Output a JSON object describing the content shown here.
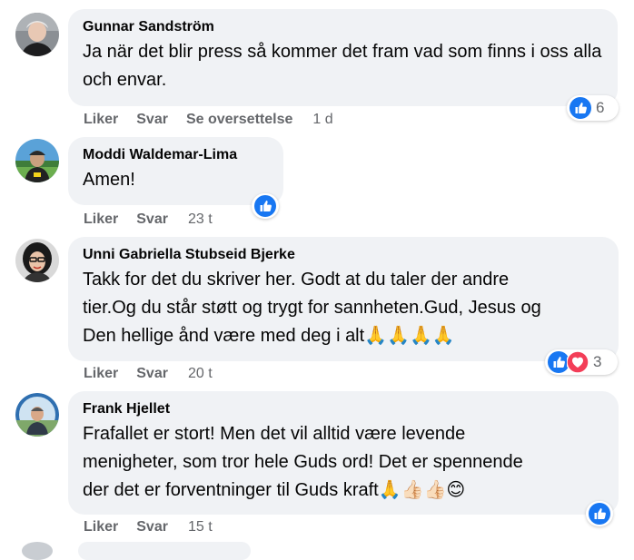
{
  "comments": [
    {
      "author": "Gunnar Sandström",
      "text": "Ja när det blir press så kommer det fram vad som finns i oss alla och envar.",
      "actions": {
        "like": "Liker",
        "reply": "Svar",
        "translate": "Se oversettelse"
      },
      "time": "1 d",
      "reactions": {
        "types": [
          "like"
        ],
        "count": "6"
      }
    },
    {
      "author": "Moddi Waldemar-Lima",
      "text": "Amen!",
      "actions": {
        "like": "Liker",
        "reply": "Svar"
      },
      "time": "23 t",
      "reactions": {
        "types": [
          "like"
        ],
        "count": ""
      }
    },
    {
      "author": "Unni Gabriella Stubseid Bjerke",
      "text_line1": "Takk for det du skriver her. Godt at du taler der andre",
      "text_line2": "tier.Og du står støtt og trygt for sannheten.Gud, Jesus og",
      "text_line3": "Den hellige ånd være med deg i alt",
      "text_emoji": "🙏🙏🙏🙏",
      "actions": {
        "like": "Liker",
        "reply": "Svar"
      },
      "time": "20 t",
      "reactions": {
        "types": [
          "like",
          "love"
        ],
        "count": "3"
      }
    },
    {
      "author": "Frank Hjellet",
      "text_line1": "Frafallet er stort! Men det vil alltid være levende",
      "text_line2": "menigheter, som tror hele Guds ord! Det er spennende",
      "text_line3": "der det er forventninger til Guds kraft",
      "text_emoji": "🙏👍🏻👍🏻😊",
      "actions": {
        "like": "Liker",
        "reply": "Svar"
      },
      "time": "15 t",
      "reactions": {
        "types": [
          "like"
        ],
        "count": ""
      }
    }
  ],
  "colors": {
    "like_blue": "#1877f2",
    "love_red": "#f33e58",
    "bubble_bg": "#f0f2f5",
    "meta_gray": "#65676b"
  },
  "icons": {
    "like": "thumbs-up-icon",
    "love": "heart-icon"
  }
}
